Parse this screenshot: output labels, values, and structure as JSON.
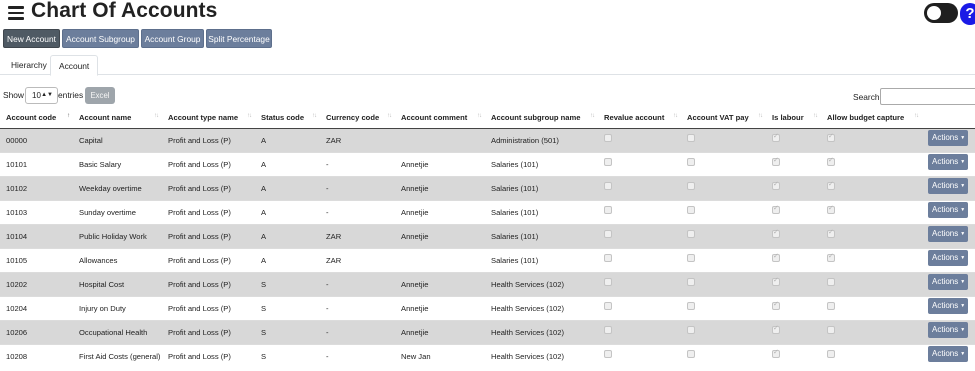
{
  "header": {
    "title": "Chart Of Accounts"
  },
  "toolbar": {
    "new_account": "New Account",
    "account_subgroup": "Account Subgroup",
    "account_group": "Account Group",
    "split_percentage": "Split Percentage"
  },
  "tabs": [
    {
      "label": "Hierarchy",
      "active": false
    },
    {
      "label": "Account",
      "active": true
    }
  ],
  "table_controls": {
    "show_label": "Show",
    "entries_value": "10",
    "entries_label": "entries",
    "excel_label": "Excel",
    "search_label": "Search:",
    "search_value": ""
  },
  "columns": [
    "Account code",
    "Account name",
    "Account type name",
    "Status code",
    "Currency code",
    "Account comment",
    "Account subgroup name",
    "Revalue account",
    "Account VAT pay",
    "Is labour",
    "Allow budget capture"
  ],
  "actions_label": "Actions",
  "rows": [
    {
      "code": "00000",
      "name": "Capital",
      "type": "Profit and Loss (P)",
      "status": "A",
      "currency": "ZAR",
      "comment": "",
      "subgroup": "Administration (501)",
      "revalue": false,
      "vat": false,
      "labour": true,
      "budget": true
    },
    {
      "code": "10101",
      "name": "Basic Salary",
      "type": "Profit and Loss (P)",
      "status": "A",
      "currency": "-",
      "comment": "Annetjie",
      "subgroup": "Salaries (101)",
      "revalue": false,
      "vat": false,
      "labour": true,
      "budget": true
    },
    {
      "code": "10102",
      "name": "Weekday overtime",
      "type": "Profit and Loss (P)",
      "status": "A",
      "currency": "-",
      "comment": "Annetjie",
      "subgroup": "Salaries (101)",
      "revalue": false,
      "vat": false,
      "labour": true,
      "budget": true
    },
    {
      "code": "10103",
      "name": "Sunday overtime",
      "type": "Profit and Loss (P)",
      "status": "A",
      "currency": "-",
      "comment": "Annetjie",
      "subgroup": "Salaries (101)",
      "revalue": false,
      "vat": false,
      "labour": true,
      "budget": true
    },
    {
      "code": "10104",
      "name": "Public Holiday Work",
      "type": "Profit and Loss (P)",
      "status": "A",
      "currency": "ZAR",
      "comment": "Annetjie",
      "subgroup": "Salaries (101)",
      "revalue": false,
      "vat": false,
      "labour": true,
      "budget": true
    },
    {
      "code": "10105",
      "name": "Allowances",
      "type": "Profit and Loss (P)",
      "status": "A",
      "currency": "ZAR",
      "comment": "",
      "subgroup": "Salaries (101)",
      "revalue": false,
      "vat": false,
      "labour": true,
      "budget": true
    },
    {
      "code": "10202",
      "name": "Hospital Cost",
      "type": "Profit and Loss (P)",
      "status": "S",
      "currency": "-",
      "comment": "Annetjie",
      "subgroup": "Health Services (102)",
      "revalue": false,
      "vat": false,
      "labour": true,
      "budget": false
    },
    {
      "code": "10204",
      "name": "Injury on Duty",
      "type": "Profit and Loss (P)",
      "status": "S",
      "currency": "-",
      "comment": "Annetjie",
      "subgroup": "Health Services (102)",
      "revalue": false,
      "vat": false,
      "labour": true,
      "budget": false
    },
    {
      "code": "10206",
      "name": "Occupational Health",
      "type": "Profit and Loss (P)",
      "status": "S",
      "currency": "-",
      "comment": "Annetjie",
      "subgroup": "Health Services (102)",
      "revalue": false,
      "vat": false,
      "labour": true,
      "budget": false
    },
    {
      "code": "10208",
      "name": "First Aid Costs (general)",
      "type": "Profit and Loss (P)",
      "status": "S",
      "currency": "-",
      "comment": "New Jan",
      "subgroup": "Health Services (102)",
      "revalue": false,
      "vat": false,
      "labour": true,
      "budget": false
    }
  ]
}
